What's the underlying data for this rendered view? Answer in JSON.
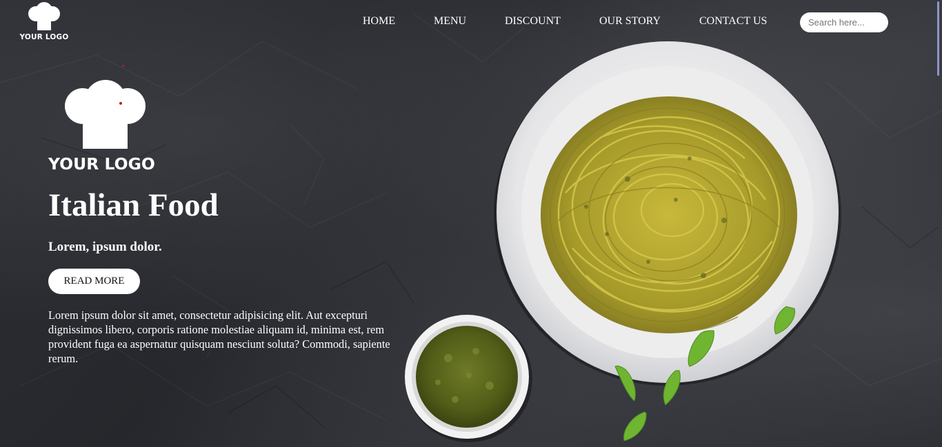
{
  "header": {
    "logo_text": "YOUR LOGO",
    "nav": [
      {
        "label": "HOME"
      },
      {
        "label": "MENU"
      },
      {
        "label": "DISCOUNT"
      },
      {
        "label": "OUR STORY"
      },
      {
        "label": "CONTACT US"
      }
    ],
    "search": {
      "placeholder": "Search here..."
    }
  },
  "hero": {
    "logo_text": "YOUR LOGO",
    "title": "Italian Food",
    "subtitle": "Lorem, ipsum dolor.",
    "button_label": "READ MORE",
    "body": "Lorem ipsum dolor sit amet, consectetur adipisicing elit. Aut excepturi dignissimos libero, corporis ratione molestiae aliquam id, minima est, rem provident fuga ea aspernatur quisquam nesciunt soluta? Commodi, sapiente rerum."
  },
  "colors": {
    "background": "#2a2c31",
    "text": "#ffffff",
    "button_bg": "#ffffff",
    "button_text": "#111111",
    "pasta": "#b8a830",
    "pesto": "#5e6a1e",
    "basil": "#6fb531"
  },
  "icons": {
    "header_logo": "chef-hat-icon",
    "hero_logo": "chef-hat-icon"
  }
}
